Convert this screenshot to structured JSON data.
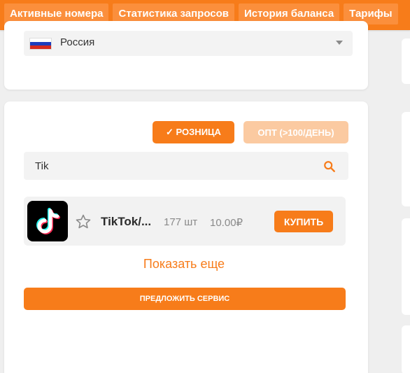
{
  "nav": {
    "tabs": [
      "Активные номера",
      "Статистика запросов",
      "История баланса",
      "Тарифы"
    ]
  },
  "country": {
    "selected": "Россия"
  },
  "modes": {
    "retail_label": "✓ РОЗНИЦА",
    "opt_label": "ОПТ (>100/ДЕНЬ)"
  },
  "search": {
    "value": "Tik"
  },
  "services": [
    {
      "name": "TikTok/...",
      "qty": "177 шт",
      "price": "10.00₽",
      "buy_label": "КУПИТЬ"
    }
  ],
  "show_more_label": "Показать еще",
  "suggest_label": "ПРЕДЛОЖИТЬ СЕРВИС",
  "colors": {
    "accent": "#f77c1a",
    "accent_light": "#fbcaa1",
    "background": "#efefef"
  }
}
